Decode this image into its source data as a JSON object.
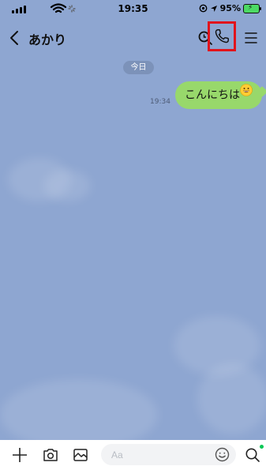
{
  "status_bar": {
    "time": "19:35",
    "battery_percent": "95%",
    "battery_level": 0.95
  },
  "header": {
    "chat_name": "あかり",
    "back_icon": "chevron-left-icon",
    "search_icon": "search-icon",
    "call_icon": "phone-icon",
    "menu_icon": "menu-icon",
    "highlight_color": "#e1141c"
  },
  "chat": {
    "date_label": "今日",
    "messages": [
      {
        "time": "19:34",
        "text": "こんにちは",
        "emoji": "grinning-face-icon",
        "bubble_color": "#98d86b"
      }
    ],
    "background_color": "#8ea6d1"
  },
  "input_bar": {
    "placeholder": "Aa",
    "add_icon": "plus-icon",
    "camera_icon": "camera-icon",
    "image_icon": "image-icon",
    "emoji_icon": "emoji-icon",
    "search_icon": "search-icon"
  }
}
